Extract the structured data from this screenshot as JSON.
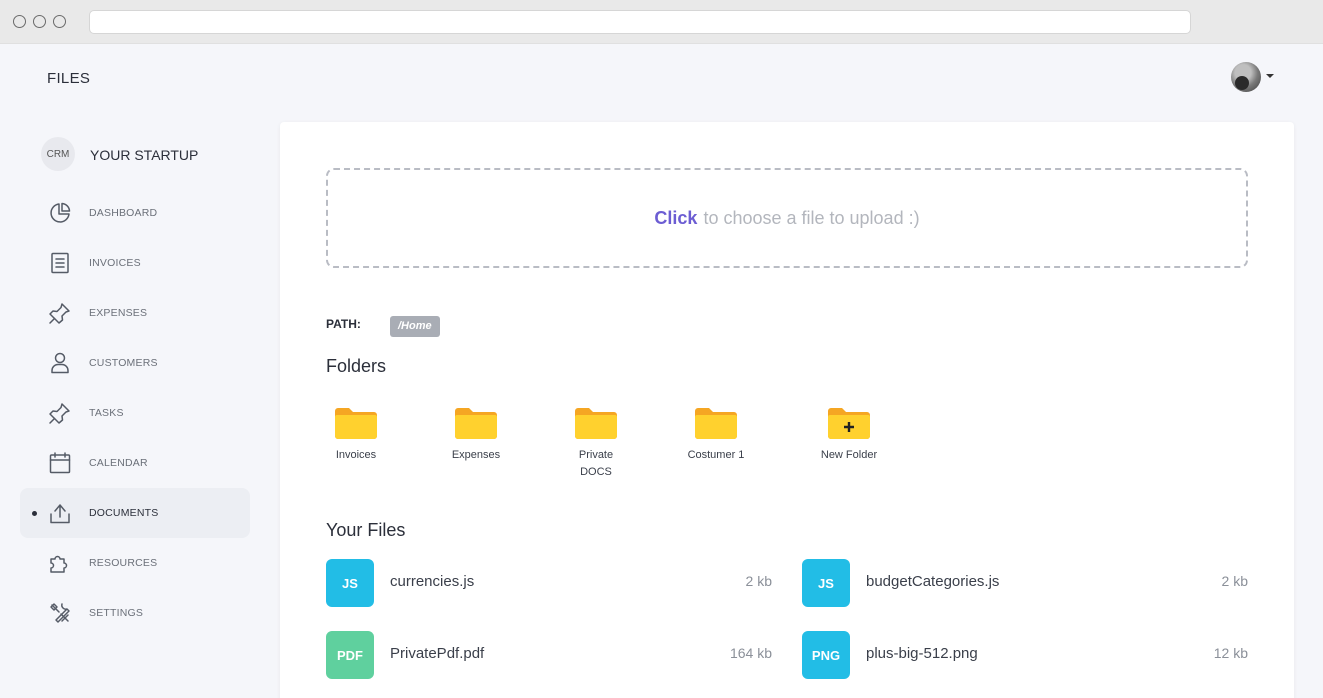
{
  "header": {
    "title": "FILES"
  },
  "user": {
    "avatar_alt": "user avatar"
  },
  "sidebar": {
    "brand_badge": "CRM",
    "brand_name": "YOUR STARTUP",
    "items": [
      {
        "label": "DASHBOARD",
        "icon": "pie-chart-icon"
      },
      {
        "label": "INVOICES",
        "icon": "invoice-icon"
      },
      {
        "label": "EXPENSES",
        "icon": "pin-icon"
      },
      {
        "label": "CUSTOMERS",
        "icon": "user-icon"
      },
      {
        "label": "TASKS",
        "icon": "pin-icon"
      },
      {
        "label": "CALENDAR",
        "icon": "calendar-icon"
      },
      {
        "label": "DOCUMENTS",
        "icon": "upload-icon",
        "active": true
      },
      {
        "label": "RESOURCES",
        "icon": "puzzle-icon"
      },
      {
        "label": "SETTINGS",
        "icon": "tools-icon"
      }
    ]
  },
  "upload": {
    "click_text": "Click",
    "rest_text": "to choose a file to upload :)"
  },
  "path": {
    "label": "PATH:",
    "value": "/Home"
  },
  "folders": {
    "title": "Folders",
    "items": [
      {
        "label_line1": "Invoices",
        "label_line2": ""
      },
      {
        "label_line1": "Expenses",
        "label_line2": ""
      },
      {
        "label_line1": "Private",
        "label_line2": "DOCS"
      },
      {
        "label_line1": "Costumer 1",
        "label_line2": ""
      },
      {
        "label_line1": "New Folder",
        "label_line2": ""
      }
    ]
  },
  "files": {
    "title": "Your Files",
    "items": [
      {
        "type": "JS",
        "name": "currencies.js",
        "size": "2 kb",
        "color": "#22bde6"
      },
      {
        "type": "JS",
        "name": "budgetCategories.js",
        "size": "2 kb",
        "color": "#22bde6"
      },
      {
        "type": "PDF",
        "name": "PrivatePdf.pdf",
        "size": "164 kb",
        "color": "#5fd09e"
      },
      {
        "type": "PNG",
        "name": "plus-big-512.png",
        "size": "12 kb",
        "color": "#22bde6"
      }
    ]
  },
  "colors": {
    "accent": "#6c5dd3",
    "folder": "#ffd12e",
    "folder_tab": "#f5a623"
  }
}
